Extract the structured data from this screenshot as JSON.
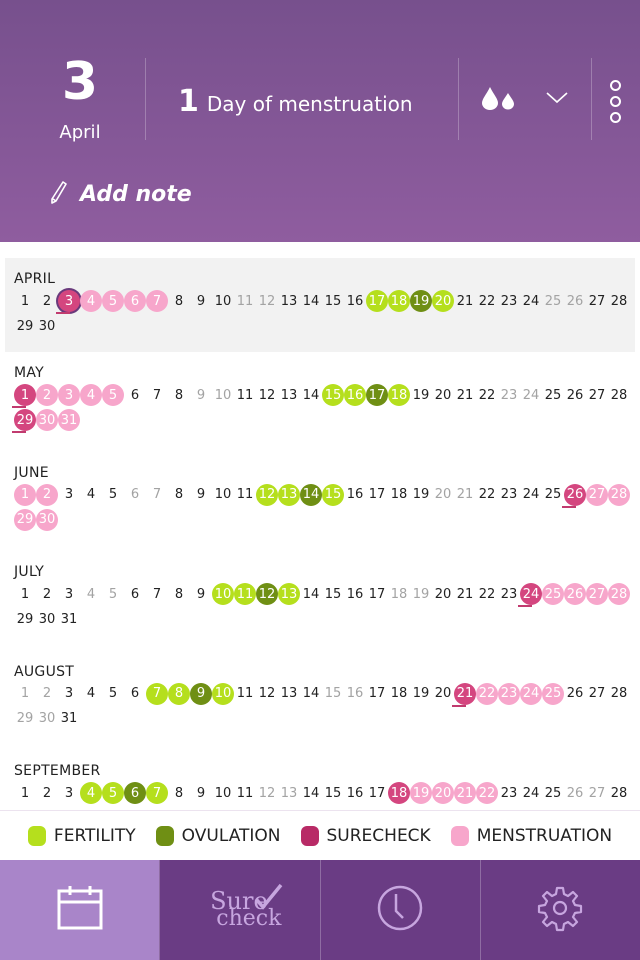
{
  "header": {
    "day": "3",
    "month": "April",
    "cycle_day": "1",
    "cycle_label": "Day of menstruation",
    "flow_icon": "two-drops-icon",
    "add_note": "Add note"
  },
  "calendar": {
    "months": [
      {
        "name": "APRIL",
        "days": 30,
        "gray": [
          11,
          12,
          25,
          26
        ],
        "men": [
          4,
          5,
          6,
          7
        ],
        "sure": [
          3
        ],
        "fert": [
          17,
          18,
          20
        ],
        "ovu": [
          19
        ],
        "today": 3,
        "mark": [
          3
        ]
      },
      {
        "name": "MAY",
        "days": 31,
        "gray": [
          9,
          10,
          23,
          24
        ],
        "men": [
          2,
          3,
          4,
          5,
          30,
          31
        ],
        "sure": [
          1,
          29
        ],
        "fert": [
          15,
          16,
          18
        ],
        "ovu": [
          17
        ],
        "mark": [
          1,
          29
        ]
      },
      {
        "name": "JUNE",
        "days": 30,
        "gray": [
          6,
          7,
          20,
          21
        ],
        "men": [
          1,
          2,
          27,
          28,
          29,
          30
        ],
        "sure": [
          26
        ],
        "fert": [
          12,
          13,
          15
        ],
        "ovu": [
          14
        ],
        "mark": [
          26
        ]
      },
      {
        "name": "JULY",
        "days": 31,
        "gray": [
          4,
          5,
          18,
          19
        ],
        "men": [
          25,
          26,
          27,
          28
        ],
        "sure": [
          24
        ],
        "fert": [
          10,
          11,
          13
        ],
        "ovu": [
          12
        ],
        "mark": [
          24
        ]
      },
      {
        "name": "AUGUST",
        "days": 31,
        "gray": [
          1,
          2,
          15,
          16,
          29,
          30
        ],
        "men": [
          22,
          23,
          24,
          25
        ],
        "sure": [
          21
        ],
        "fert": [
          7,
          8,
          10
        ],
        "ovu": [
          9
        ],
        "mark": [
          21
        ]
      },
      {
        "name": "SEPTEMBER",
        "days": 28,
        "gray": [
          12,
          13,
          26,
          27
        ],
        "men": [
          19,
          20,
          21,
          22
        ],
        "sure": [
          18
        ],
        "fert": [
          4,
          5,
          7
        ],
        "ovu": [
          6
        ],
        "mark": []
      }
    ]
  },
  "legend": [
    {
      "label": "FERTILITY",
      "color": "#b5df1d"
    },
    {
      "label": "OVULATION",
      "color": "#6f8f14"
    },
    {
      "label": "SURECHECK",
      "color": "#b82a66"
    },
    {
      "label": "MENSTRUATION",
      "color": "#f7a6cb"
    }
  ],
  "tabs": [
    {
      "name": "calendar",
      "icon": "calendar-icon",
      "active": true
    },
    {
      "name": "surecheck",
      "logo_top": "Sure",
      "logo_bottom": "check",
      "active": false
    },
    {
      "name": "history",
      "icon": "clock-icon",
      "active": false
    },
    {
      "name": "settings",
      "icon": "gear-icon",
      "active": false
    }
  ]
}
